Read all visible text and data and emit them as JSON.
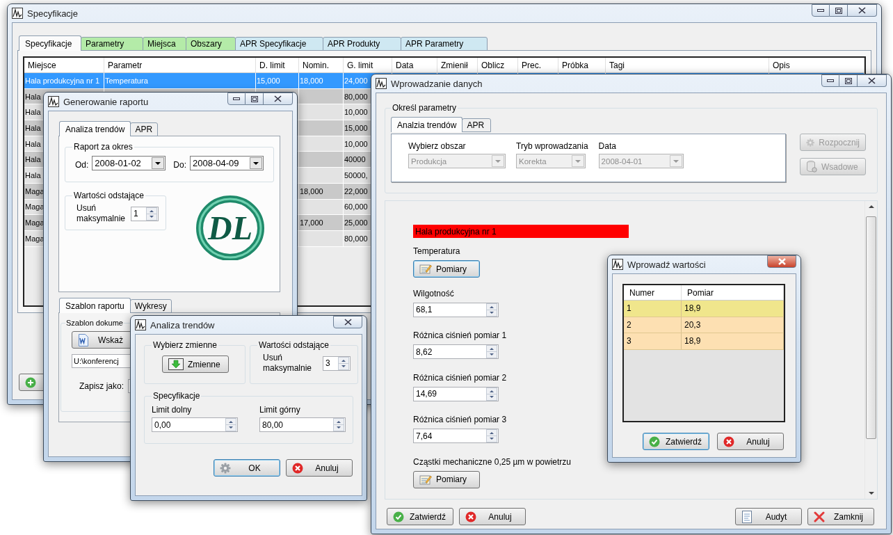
{
  "spec_window": {
    "title": "Specyfikacje",
    "tabs": [
      {
        "label": "Specyfikacje",
        "selected": true,
        "color": "#fbfbfb"
      },
      {
        "label": "Parametry",
        "selected": false,
        "color": "#b4eba8"
      },
      {
        "label": "Miejsca",
        "selected": false,
        "color": "#b4eba8"
      },
      {
        "label": "Obszary",
        "selected": false,
        "color": "#b4eba8"
      },
      {
        "label": "APR Specyfikacje",
        "selected": false,
        "color": "#cfe8f2"
      },
      {
        "label": "APR Produkty",
        "selected": false,
        "color": "#cfe8f2"
      },
      {
        "label": "APR Parametry",
        "selected": false,
        "color": "#cfe8f2"
      }
    ],
    "table": {
      "columns": [
        "Miejsce",
        "Parametr",
        "D. limit",
        "Nomin.",
        "G. limit",
        "Data",
        "Zmienił",
        "Oblicz",
        "Prec.",
        "Próbka",
        "Tagi",
        "Opis"
      ],
      "rows": [
        {
          "selected": true,
          "cells": [
            "Hala produkcyjna nr 1",
            "Temperatura",
            "15,000",
            "18,000",
            "24,000"
          ]
        },
        {
          "selected": false,
          "cells": [
            "Hala",
            null,
            null,
            null,
            "80,000"
          ]
        },
        {
          "selected": false,
          "cells": [
            "Hala",
            null,
            null,
            null,
            "10,000"
          ]
        },
        {
          "selected": false,
          "cells": [
            "Hala",
            null,
            null,
            null,
            "15,000"
          ]
        },
        {
          "selected": false,
          "cells": [
            "Hala",
            null,
            null,
            null,
            "10,000"
          ]
        },
        {
          "selected": false,
          "cells": [
            "Hala",
            null,
            null,
            null,
            "40000"
          ]
        },
        {
          "selected": false,
          "cells": [
            "Hala",
            null,
            null,
            null,
            "50000,"
          ]
        },
        {
          "selected": false,
          "cells": [
            "Maga",
            null,
            null,
            "18,000",
            "22,000"
          ]
        },
        {
          "selected": false,
          "cells": [
            "Maga",
            null,
            null,
            null,
            "60,000"
          ]
        },
        {
          "selected": false,
          "cells": [
            "Maga",
            null,
            null,
            "17,000",
            "25,000"
          ]
        },
        {
          "selected": false,
          "cells": [
            "Maga",
            null,
            null,
            null,
            "80,000"
          ]
        }
      ]
    }
  },
  "report_window": {
    "title": "Generowanie raportu",
    "top_tabs": [
      {
        "label": "Analiza trendów",
        "selected": true
      },
      {
        "label": "APR",
        "selected": false
      }
    ],
    "period_group": {
      "title": "Raport za okres",
      "from_label": "Od:",
      "from_value": "2008-01-02",
      "to_label": "Do:",
      "to_value": "2008-04-09"
    },
    "outliers_group": {
      "title": "Wartości odstające",
      "label": "Usuń maksymalnie",
      "value": "1"
    },
    "logo_text": "DL",
    "bottom_tabs": [
      {
        "label": "Szablon raportu",
        "selected": true
      },
      {
        "label": "Wykresy",
        "selected": false
      }
    ],
    "template_group": {
      "title": "Szablon dokume",
      "browse_button": "Wskaż",
      "path_value": "U:\\konferencj",
      "save_as_label": "Zapisz jako:"
    }
  },
  "trend_window": {
    "title": "Analiza trendów",
    "variables_group": {
      "title": "Wybierz zmienne",
      "button": "Zmienne"
    },
    "outliers_group": {
      "title": "Wartości odstające",
      "label": "Usuń maksymalnie",
      "value": "3"
    },
    "spec_group": {
      "title": "Specyfikacje",
      "lower_label": "Limit dolny",
      "lower_value": "0,00",
      "upper_label": "Limit górny",
      "upper_value": "80,00"
    },
    "buttons": [
      {
        "label": "OK",
        "kind": "ok",
        "focused": true
      },
      {
        "label": "Anuluj",
        "kind": "cancel",
        "focused": false
      }
    ]
  },
  "entry_window": {
    "title": "Wprowadzanie danych",
    "params_group": {
      "title": "Określ parametry",
      "tabs": [
        {
          "label": "Analzia trendów",
          "selected": true
        },
        {
          "label": "APR",
          "selected": false
        }
      ],
      "fields": [
        {
          "label": "Wybierz obszar",
          "value": "Produkcja",
          "disabled": true
        },
        {
          "label": "Tryb wprowadzania",
          "value": "Korekta",
          "disabled": true
        },
        {
          "label": "Data",
          "value": "2008-04-01",
          "disabled": true
        }
      ],
      "buttons": [
        {
          "label": "Rozpocznij",
          "kind": "start",
          "disabled": true
        },
        {
          "label": "Wsadowe",
          "kind": "batch",
          "disabled": true
        }
      ]
    },
    "location": "Hala produkcyjna nr 1",
    "inputs": [
      {
        "kind": "button",
        "label": "Temperatura",
        "button": "Pomiary",
        "focused": true
      },
      {
        "kind": "spinner",
        "label": "Wilgotność",
        "value": "68,1"
      },
      {
        "kind": "spinner",
        "label": "Różnica ciśnień pomiar 1",
        "value": "8,62"
      },
      {
        "kind": "spinner",
        "label": "Różnica ciśnień pomiar 2",
        "value": "14,69"
      },
      {
        "kind": "spinner",
        "label": "Różnica ciśnień pomiar 3",
        "value": "7,64"
      },
      {
        "kind": "button",
        "label": "Cząstki mechaniczne 0,25 µm w powietrzu",
        "button": "Pomiary",
        "focused": false
      }
    ],
    "footer_buttons": [
      {
        "label": "Zatwierdź",
        "kind": "confirm"
      },
      {
        "label": "Anuluj",
        "kind": "cancel"
      },
      {
        "label": "Audyt",
        "kind": "audit"
      },
      {
        "label": "Zamknij",
        "kind": "close"
      }
    ]
  },
  "values_window": {
    "title": "Wprowadź wartości",
    "columns": [
      "Numer",
      "Pomiar"
    ],
    "rows": [
      {
        "cells": [
          "1",
          "18,9"
        ],
        "selected": true
      },
      {
        "cells": [
          "2",
          "20,3"
        ],
        "selected": false
      },
      {
        "cells": [
          "3",
          "18,9"
        ],
        "selected": false
      }
    ],
    "buttons": [
      {
        "label": "Zatwierdź",
        "kind": "confirm",
        "focused": true
      },
      {
        "label": "Anuluj",
        "kind": "cancel",
        "focused": false
      }
    ]
  }
}
